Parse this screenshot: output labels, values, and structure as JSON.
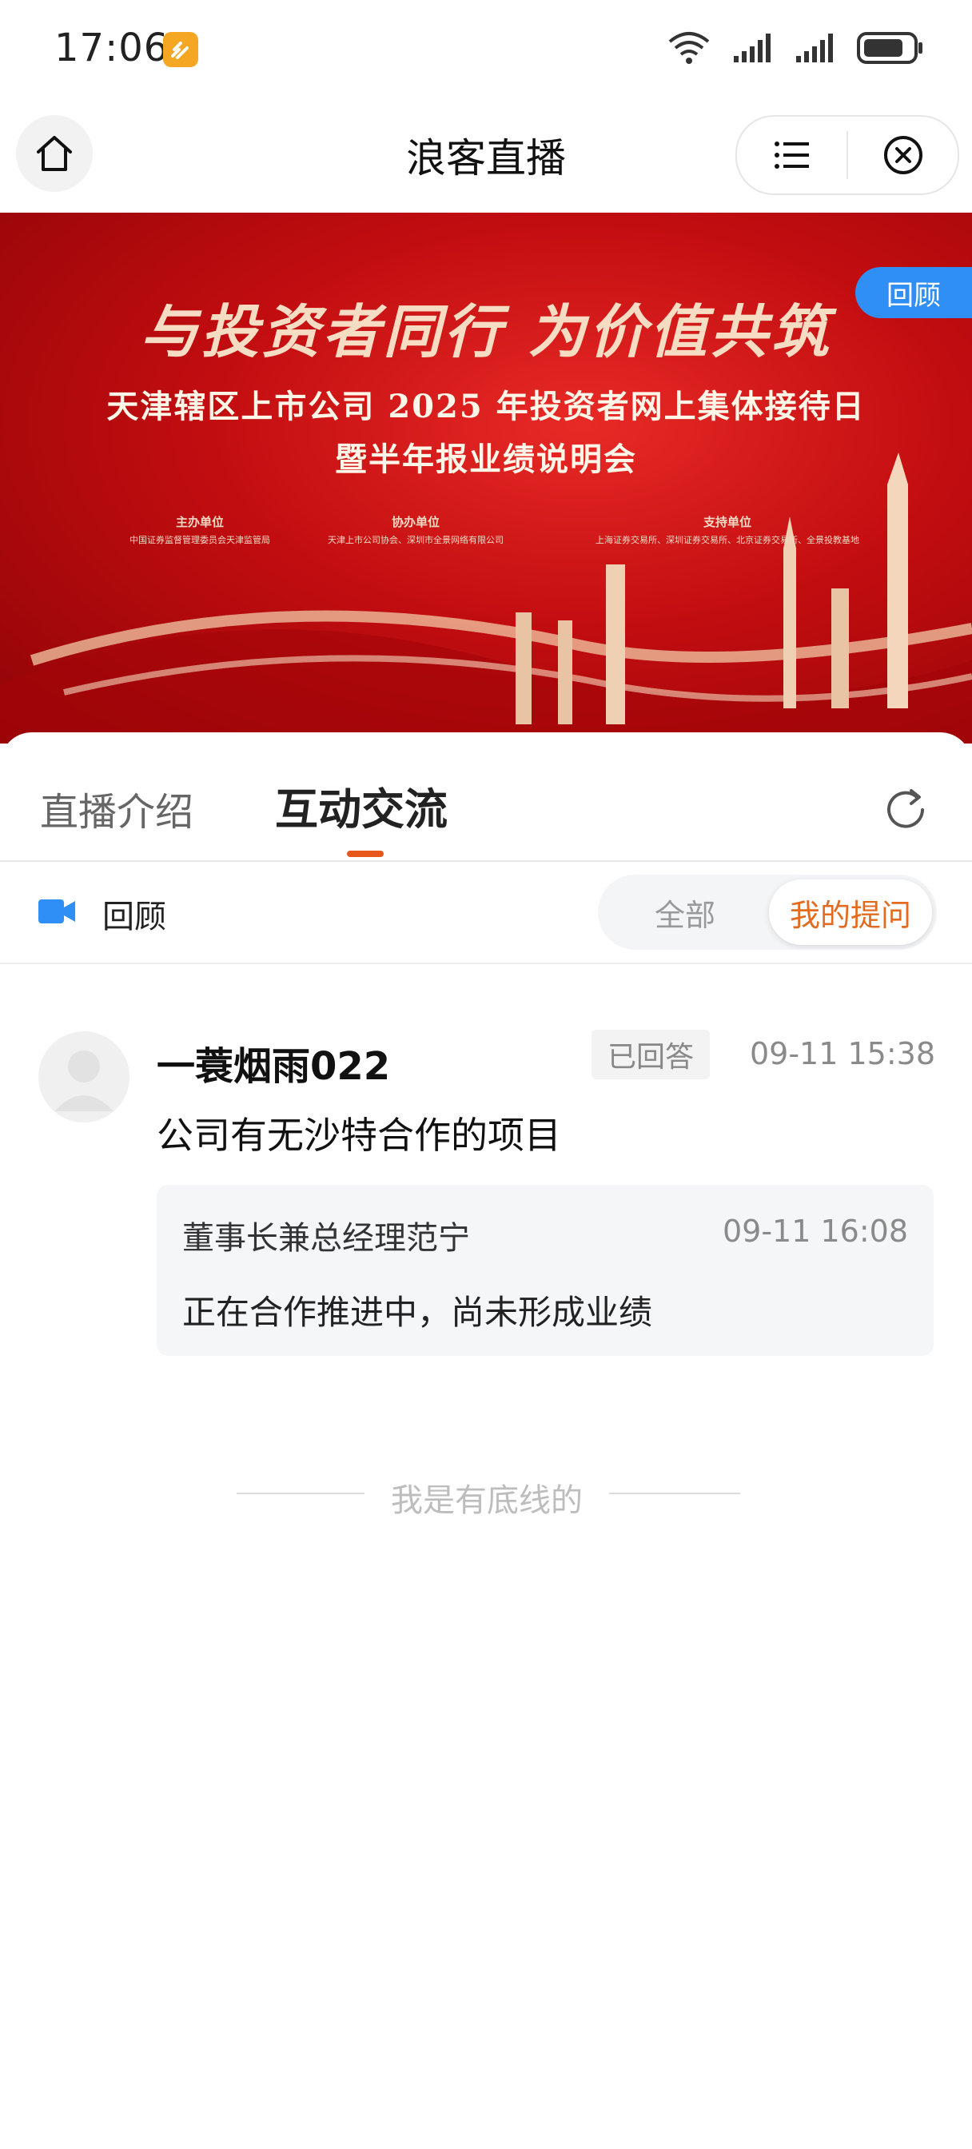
{
  "status_bar": {
    "time": "17:06",
    "icons": [
      "wifi-icon",
      "signal-icon",
      "signal-icon",
      "battery-icon"
    ]
  },
  "nav": {
    "title": "浪客直播",
    "home_icon": "home-icon",
    "menu_icon": "list-menu-icon",
    "close_icon": "close-circle-icon"
  },
  "banner": {
    "slogan": "与投资者同行 为价值共筑",
    "title": "天津辖区上市公司 2025 年投资者网上集体接待日",
    "subtitle": "暨半年报业绩说明会",
    "orgs": [
      {
        "label": "主办单位",
        "text": "中国证券监督管理委员会天津监管局"
      },
      {
        "label": "协办单位",
        "text": "天津上市公司协会、深圳市全景网络有限公司"
      },
      {
        "label": "支持单位",
        "text": "上海证券交易所、深圳证券交易所、北京证券交易所、全景投教基地"
      }
    ],
    "badge": "回顾",
    "colors": {
      "primary": "#c20d10",
      "gold": "#f6dcc2"
    }
  },
  "tabs": [
    {
      "label": "直播介绍",
      "active": false
    },
    {
      "label": "互动交流",
      "active": true
    }
  ],
  "replay_row": {
    "label": "回顾",
    "icon": "video-camera-icon"
  },
  "filters": {
    "all": "全部",
    "mine": "我的提问",
    "selected": "mine"
  },
  "question": {
    "username": "一蓑烟雨022",
    "status": "已回答",
    "time": "09-11 15:38",
    "text": "公司有无沙特合作的项目",
    "answer": {
      "author": "董事长兼总经理范宁",
      "time": "09-11 16:08",
      "text": "正在合作推进中，尚未形成业绩"
    }
  },
  "footer": "我是有底线的",
  "colors": {
    "accent": "#e26b1f",
    "badge_blue": "#2f8ff5"
  }
}
